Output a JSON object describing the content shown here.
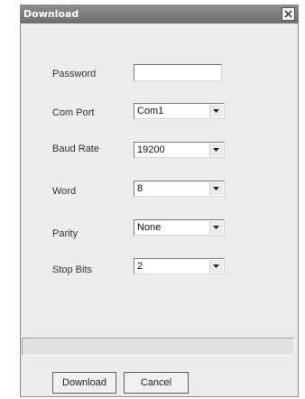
{
  "window": {
    "title": "Download"
  },
  "form": {
    "password": {
      "label": "Password",
      "value": ""
    },
    "com_port": {
      "label": "Com Port",
      "value": "Com1"
    },
    "baud_rate": {
      "label": "Baud Rate",
      "value": "19200"
    },
    "word": {
      "label": "Word",
      "value": "8"
    },
    "parity": {
      "label": "Parity",
      "value": "None"
    },
    "stop_bits": {
      "label": "Stop Bits",
      "value": "2"
    }
  },
  "status": {
    "text": ""
  },
  "buttons": {
    "download": "Download",
    "cancel": "Cancel"
  }
}
